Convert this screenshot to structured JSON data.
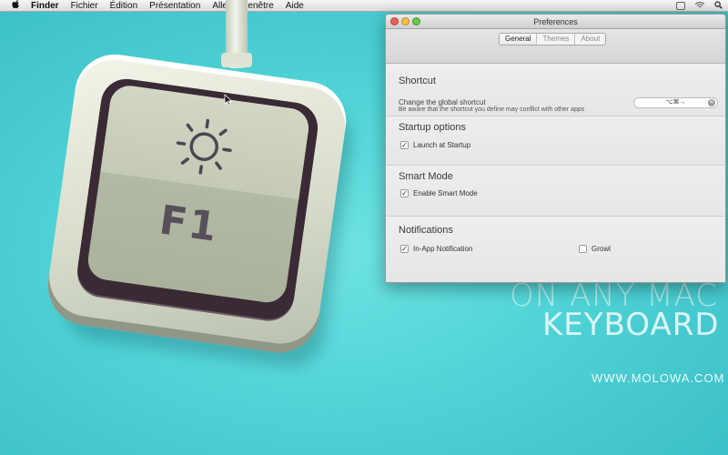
{
  "menubar": {
    "apple": "",
    "items": [
      "Finder",
      "Fichier",
      "Édition",
      "Présentation",
      "Aller",
      "Fenêtre",
      "Aide"
    ],
    "tray_icons": [
      "window-tray-icon",
      "wifi-icon",
      "spotlight-icon"
    ]
  },
  "key": {
    "label": "F1",
    "icon": "sun-icon"
  },
  "tagline": {
    "line1": "ON ANY MAC",
    "line2": "KEYBOARD",
    "site": "WWW.MOLOWA.COM"
  },
  "window": {
    "title": "Preferences",
    "tabs": [
      {
        "label": "General",
        "active": true
      },
      {
        "label": "Themes",
        "active": false
      },
      {
        "label": "About",
        "active": false
      }
    ],
    "shortcut": {
      "title": "Shortcut",
      "desc1": "Change the global shortcut",
      "desc2": "Be aware that the shortcut you define may conflict with other apps",
      "value": "⌥⌘→"
    },
    "startup": {
      "title": "Startup options",
      "launch_label": "Launch at Startup",
      "launch_checked": true
    },
    "smart": {
      "title": "Smart Mode",
      "enable_label": "Enable Smart Mode",
      "enable_checked": true
    },
    "notifications": {
      "title": "Notifications",
      "inapp_label": "In-App Notification",
      "inapp_checked": true,
      "growl_label": "Growl",
      "growl_checked": false
    }
  },
  "check_glyph": "✓"
}
